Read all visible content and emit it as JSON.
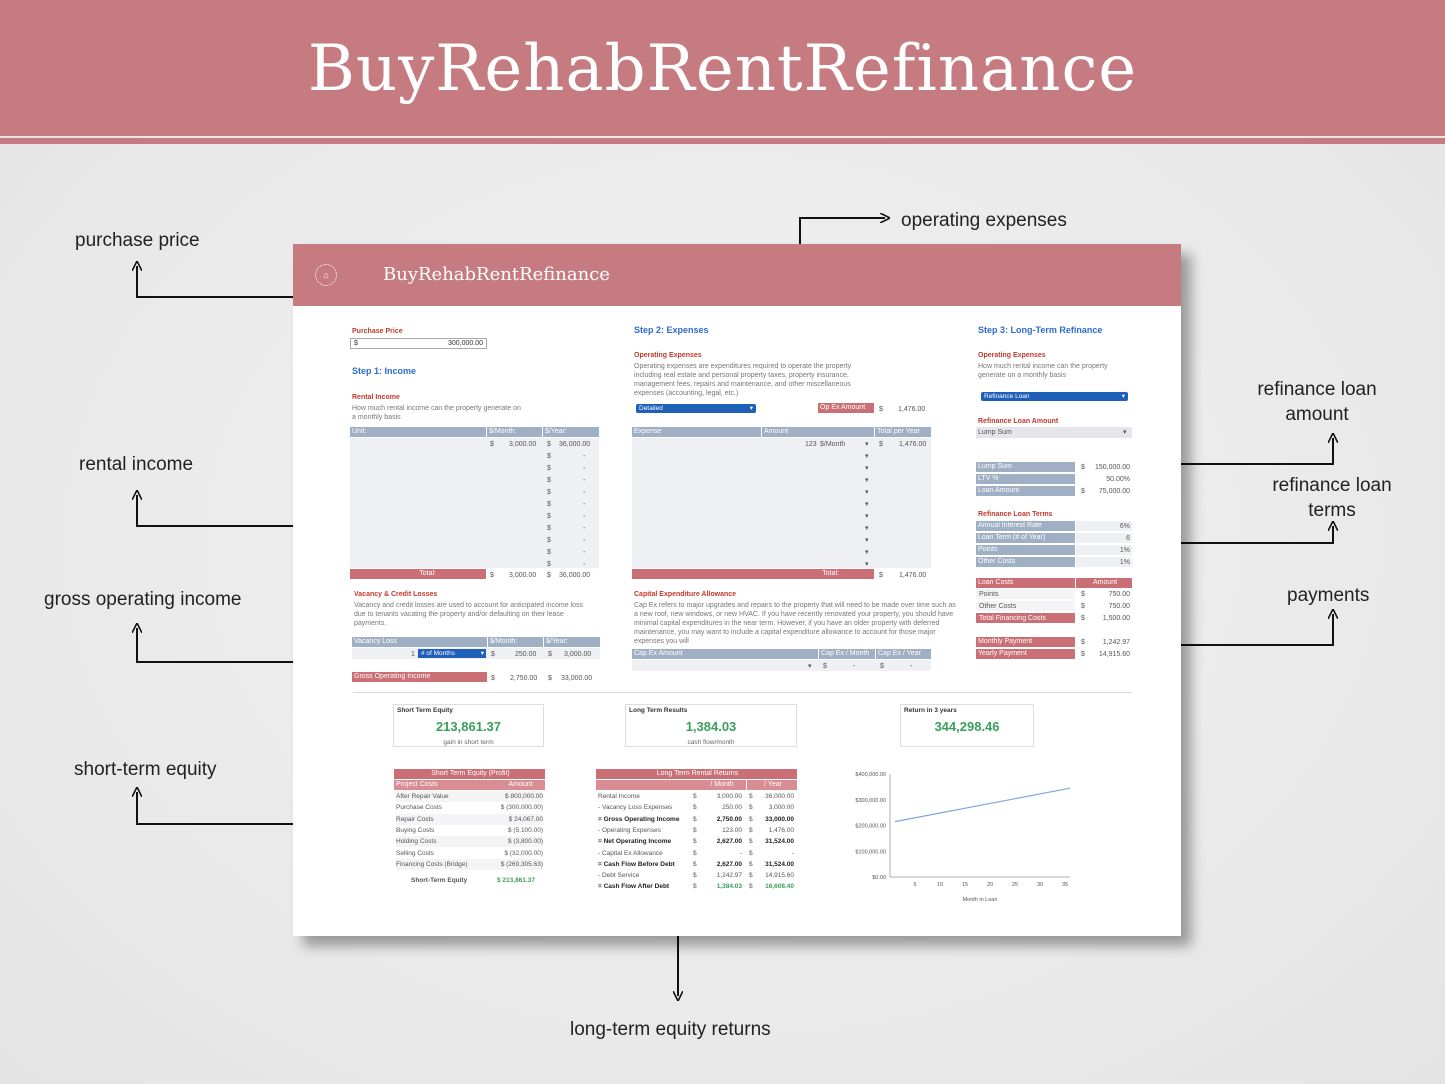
{
  "banner": {
    "title": "BuyRehabRentRefinance"
  },
  "callouts": {
    "purchase_price": "purchase price",
    "rental_income": "rental income",
    "gross_operating_income": "gross operating income",
    "short_term_equity": "short-term equity",
    "operating_expenses": "operating expenses",
    "refinance_loan_amount": "refinance loan amount",
    "refinance_loan_terms": "refinance loan terms",
    "payments": "payments",
    "long_term_equity_returns": "long-term equity returns"
  },
  "sheet": {
    "logo_text": "BuyRehabRentRefinance",
    "purchase_price": {
      "label": "Purchase Price",
      "currency": "$",
      "value": "300,000.00"
    },
    "step1": {
      "title": "Step 1: Income",
      "rental_title": "Rental Income",
      "rental_desc": "How much rental income can the property generate on a monthly basis",
      "headers": [
        "Unit:",
        "$/Month:",
        "$/Year:"
      ],
      "first_row": {
        "month": "3,000.00",
        "year": "36,000.00"
      },
      "total": {
        "label": "Total:",
        "month": "3,000.00",
        "year": "36,000.00"
      },
      "vacancy_title": "Vacancy & Credit Losses",
      "vacancy_desc": "Vacancy and credit losses are used to account for anticipated income loss due to tenants vacating the property and/or defaulting on their lease payments.",
      "vacancy_headers": [
        "Vacancy Loss",
        "$/Month:",
        "$/Year:"
      ],
      "vacancy_row": {
        "count": "1",
        "unit": "# of Months",
        "month": "250.00",
        "year": "3,000.00"
      },
      "goi": {
        "label": "Gross Operating Income",
        "month": "2,750.00",
        "year": "33,000.00"
      }
    },
    "step2": {
      "title": "Step 2: Expenses",
      "opex_title": "Operating Expenses",
      "opex_desc": "Operating expenses are expenditures required to operate the property including real estate and personal property taxes, property insurance, management fees, repairs and maintenance, and other miscellaneous expenses (accounting, legal, etc.)",
      "mode": "Detailed",
      "amount_label": "Op Ex Amount",
      "amount_value": "1,476.00",
      "headers": [
        "Expense",
        "Amount",
        "Total per Year"
      ],
      "first_row": {
        "amount": "123",
        "period": "$/Month",
        "year": "1,476.00"
      },
      "total": {
        "label": "Total:",
        "year": "1,476.00"
      },
      "capex_title": "Capital Expenditure Allowance",
      "capex_desc": "Cap Ex refers to major upgrades and repairs to the property that will need to be made over time such as a new roof, new windows, or new HVAC. If you have recently renovated your property, you should have minimal capital expenditures in the near term. However, if you have an older property with deferred maintenance, you may want to include a capital expenditure allowance to account for those major expenses you will",
      "capex_headers": [
        "Cap Ex Amount",
        "Cap Ex / Month",
        "Cap Ex / Year"
      ],
      "capex_row": {
        "month": "-",
        "year": "-"
      }
    },
    "step3": {
      "title": "Step 3: Long-Term Refinance",
      "opex_title": "Operating Expenses",
      "opex_desc": "How much rental income can the property generate on a monthly basis",
      "dropdown": "Refinance Loan",
      "amount_title": "Refinance Loan Amount",
      "amount_mode": "Lump Sum",
      "amount_rows": [
        {
          "label": "Lump Sum",
          "cur": "$",
          "value": "150,000.00"
        },
        {
          "label": "LTV %",
          "cur": "",
          "value": "50.00%"
        },
        {
          "label": "Loan Amount",
          "cur": "$",
          "value": "75,000.00"
        }
      ],
      "terms_title": "Refinance Loan Terms",
      "terms_rows": [
        {
          "label": "Annual Interest Rate",
          "value": "6%"
        },
        {
          "label": "Loan Term (# of Year)",
          "value": "6"
        },
        {
          "label": "Points",
          "value": "1%"
        },
        {
          "label": "Other Costs",
          "value": "1%"
        }
      ],
      "costs_headers": [
        "Loan Costs",
        "Amount"
      ],
      "costs_rows": [
        {
          "label": "Points",
          "value": "750.00"
        },
        {
          "label": "Other Costs",
          "value": "750.00"
        },
        {
          "label": "Total Financing Costs",
          "value": "1,500.00"
        }
      ],
      "payments": [
        {
          "label": "Monthly Payment",
          "value": "1,242.97"
        },
        {
          "label": "Yearly Payment",
          "value": "14,915.60"
        }
      ]
    },
    "summary_cards": [
      {
        "label": "Short Term Equity",
        "value": "213,861.37",
        "sub": "gain in short term"
      },
      {
        "label": "Long Term Results",
        "value": "1,384.03",
        "sub": "cash flow/month"
      },
      {
        "label": "Return in 3 years",
        "value": "344,298.46",
        "sub": ""
      }
    ],
    "short_term_table": {
      "title": "Short Term Equity (Profit)",
      "headers": [
        "Project Costs",
        "Amount"
      ],
      "rows": [
        {
          "label": "After Repair Value",
          "value": "$ 800,000.00"
        },
        {
          "label": "Purchase Costs",
          "value": "$ (300,000.00)"
        },
        {
          "label": "Repair Costs",
          "value": "$ 24,067.00"
        },
        {
          "label": "Buying Costs",
          "value": "$ (5,100.00)"
        },
        {
          "label": "Holding Costs",
          "value": "$ (3,800.00)"
        },
        {
          "label": "Selling Costs",
          "value": "$ (32,000.00)"
        },
        {
          "label": "Financing Costs (Bridge)",
          "value": "$ (269,305.63)"
        }
      ],
      "total": {
        "label": "Short-Term Equity",
        "value": "$ 213,861.37"
      }
    },
    "long_term_table": {
      "title": "Long Term Rental Returns",
      "headers": [
        "",
        "/ Month",
        "/ Year"
      ],
      "rows": [
        {
          "label": "Rental Income",
          "month": "3,000.00",
          "year": "36,000.00",
          "bold": false
        },
        {
          "label": "- Vacancy Loss Expenses",
          "month": "250.00",
          "year": "3,000.00",
          "bold": false
        },
        {
          "label": "= Gross Operating Income",
          "month": "2,750.00",
          "year": "33,000.00",
          "bold": true
        },
        {
          "label": "- Operating Expenses",
          "month": "123.00",
          "year": "1,476.00",
          "bold": false
        },
        {
          "label": "= Net Operating Income",
          "month": "2,627.00",
          "year": "31,524.00",
          "bold": true
        },
        {
          "label": "- Capital Ex Allowance",
          "month": "-",
          "year": "-",
          "bold": false
        },
        {
          "label": "= Cash Flow Before Debt",
          "month": "2,627.00",
          "year": "31,524.00",
          "bold": true
        },
        {
          "label": "- Debt Service",
          "month": "1,242.97",
          "year": "14,915.60",
          "bold": false
        },
        {
          "label": "= Cash Flow After Debt",
          "month": "1,384.03",
          "year": "16,608.40",
          "bold": true
        }
      ]
    }
  },
  "chart_data": {
    "type": "line",
    "xlabel": "Month in Loan",
    "ylabel": "",
    "x_ticks": [
      5,
      10,
      15,
      20,
      25,
      30,
      35
    ],
    "y_ticks": [
      "$0.00",
      "$100,000.00",
      "$200,000.00",
      "$300,000.00",
      "$400,000.00"
    ],
    "xlim": [
      0,
      36
    ],
    "ylim": [
      0,
      400000
    ],
    "x": [
      1,
      36
    ],
    "values": [
      215000,
      345000
    ],
    "line_color": "#7ea6e0"
  }
}
